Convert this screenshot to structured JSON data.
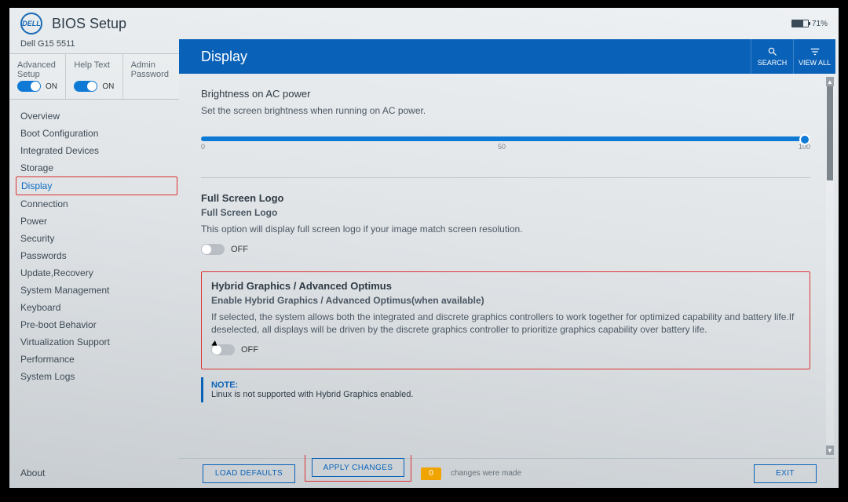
{
  "header": {
    "brand": "DELL",
    "app_title": "BIOS Setup",
    "battery_pct": "71%"
  },
  "model": "Dell G15 5511",
  "sidebar_toggles": [
    {
      "label": "Advanced Setup",
      "state": "ON",
      "on": true
    },
    {
      "label": "Help Text",
      "state": "ON",
      "on": true
    },
    {
      "label": "Admin Password",
      "state": "",
      "on": false,
      "hidden_switch": true
    }
  ],
  "nav": [
    "Overview",
    "Boot Configuration",
    "Integrated Devices",
    "Storage",
    "Display",
    "Connection",
    "Power",
    "Security",
    "Passwords",
    "Update,Recovery",
    "System Management",
    "Keyboard",
    "Pre-boot Behavior",
    "Virtualization Support",
    "Performance",
    "System Logs"
  ],
  "nav_active_index": 4,
  "about_label": "About",
  "page": {
    "title": "Display",
    "search_label": "SEARCH",
    "viewall_label": "VIEW ALL"
  },
  "brightness": {
    "title": "Brightness on AC power",
    "desc": "Set the screen brightness when running on AC power.",
    "min": "0",
    "mid": "50",
    "max": "100"
  },
  "fullscreen_logo": {
    "heading": "Full Screen Logo",
    "sub": "Full Screen Logo",
    "desc": "This option will display full screen logo if your image match screen resolution.",
    "state": "OFF"
  },
  "hybrid": {
    "heading": "Hybrid Graphics / Advanced Optimus",
    "sub": "Enable Hybrid Graphics / Advanced Optimus(when available)",
    "desc": "If selected, the system allows both the integrated and discrete graphics controllers to work together for optimized capability and battery life.If deselected, all displays will be driven by the discrete graphics controller to prioritize graphics capability over battery life.",
    "state": "OFF",
    "note_label": "NOTE:",
    "note_text": "Linux is not supported with Hybrid Graphics enabled."
  },
  "footer": {
    "load_defaults": "LOAD DEFAULTS",
    "apply": "APPLY CHANGES",
    "changes_count": "0",
    "changes_text": "changes were made",
    "exit": "EXIT"
  }
}
